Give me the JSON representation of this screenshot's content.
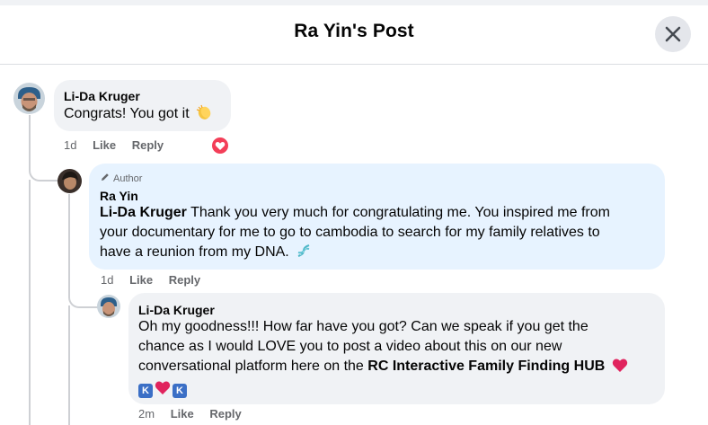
{
  "header": {
    "title": "Ra Yin's Post"
  },
  "comments": [
    {
      "author": "Li-Da Kruger",
      "text": "Congrats! You got it",
      "emoji": "clapping-hands",
      "time": "1d",
      "like": "Like",
      "reply": "Reply",
      "reaction": "love"
    },
    {
      "badge": "Author",
      "author": "Ra Yin",
      "mention": "Li-Da Kruger",
      "line1": " Thank you very much for congratulating me. You inspired me from",
      "line2": "your documentary for me to go to cambodia to search for my family relatives to",
      "line3": "have a reunion from my DNA.",
      "emoji": "dna",
      "time": "1d",
      "like": "Like",
      "reply": "Reply"
    },
    {
      "author": "Li-Da Kruger",
      "line1": "Oh my goodness!!! How far have you got? Can we speak if you get the",
      "line2": "chance as I would LOVE you to post a video about this on our new",
      "line3_prefix": "conversational platform here on the ",
      "line3_bold": "RC Interactive Family Finding HUB",
      "emoji_row": [
        "K",
        "heart",
        "K"
      ],
      "time": "2m",
      "like": "Like",
      "reply": "Reply"
    }
  ],
  "colors": {
    "love_red": "#f33e58",
    "k_blue": "#3b6fc6",
    "bubble_grey": "#f0f2f5",
    "bubble_blue": "#e7f3ff",
    "meta_grey": "#65676b"
  }
}
